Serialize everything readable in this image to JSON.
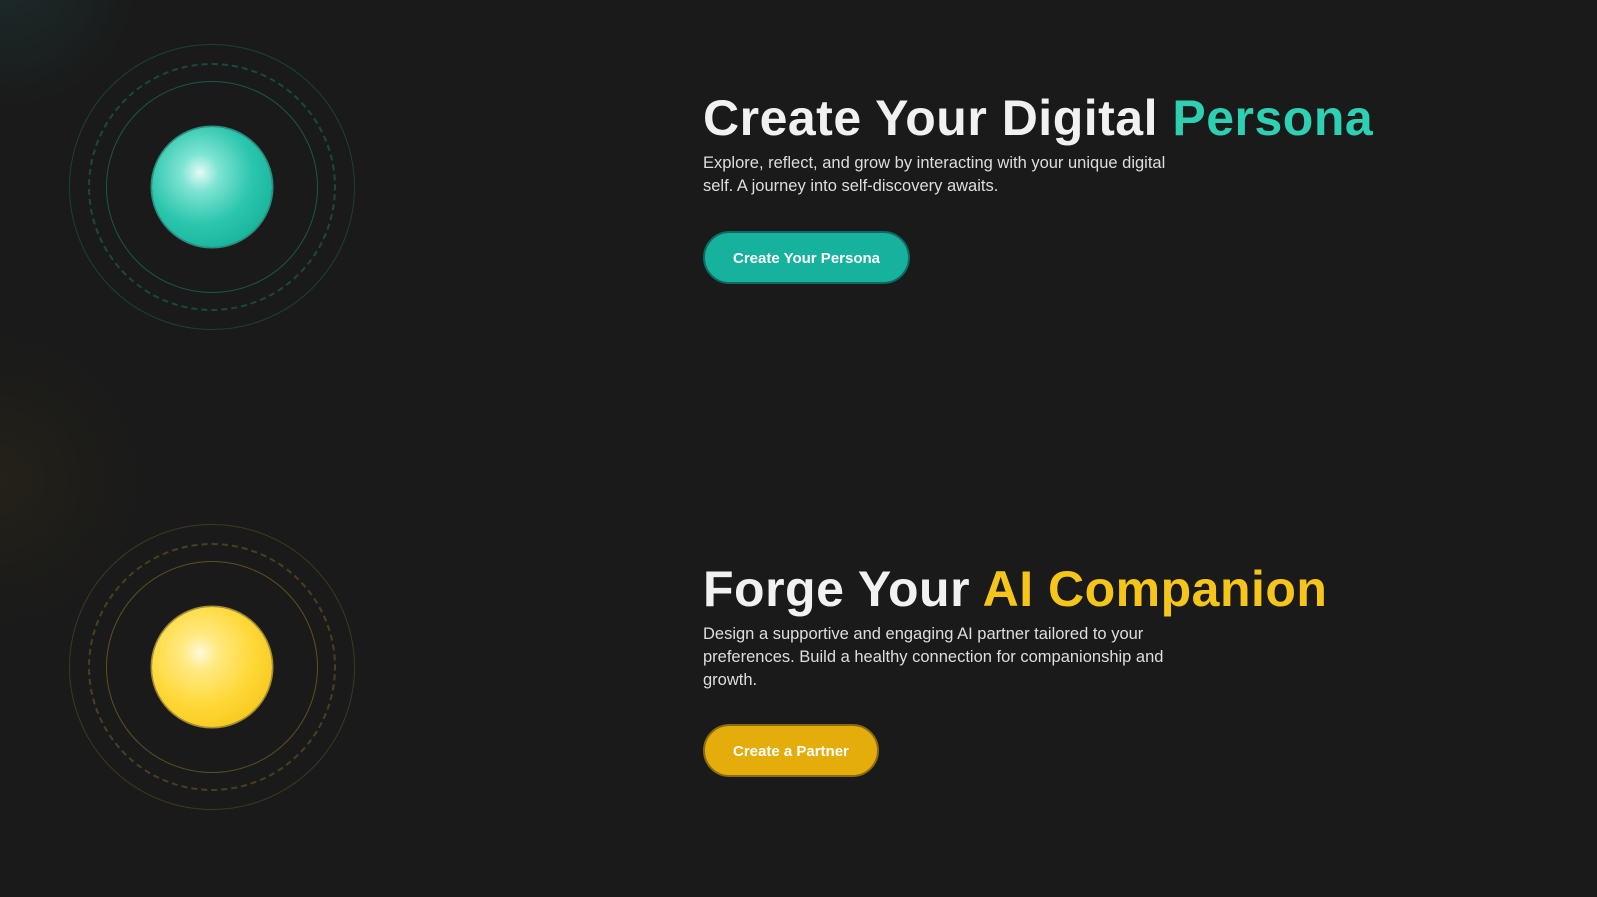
{
  "colors": {
    "background": "#1a1a1a",
    "teal_accent": "#2ed0b4",
    "teal_button": "#16b29d",
    "amber_accent": "#f5c51a",
    "amber_button": "#e5ad0b"
  },
  "sections": [
    {
      "title_prefix": "Create Your Digital ",
      "title_accent": "Persona",
      "description": "Explore, reflect, and grow by interacting with your unique digital self. A journey into self-discovery awaits.",
      "button_label": "Create Your Persona"
    },
    {
      "title_prefix": "Forge Your ",
      "title_accent": "AI Companion",
      "description": "Design a supportive and engaging AI partner tailored to your preferences. Build a healthy connection for companionship and growth.",
      "button_label": "Create a Partner"
    }
  ]
}
